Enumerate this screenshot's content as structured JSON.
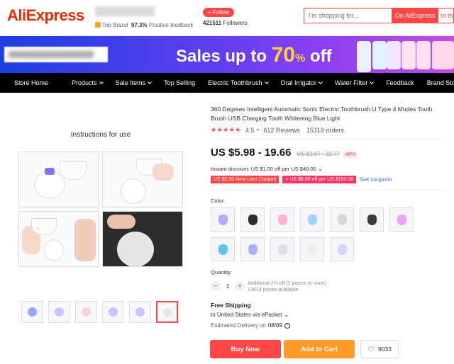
{
  "header": {
    "logo": "AliExpress",
    "store": {
      "badge": "Top Brand",
      "feedback_pct": "97.3%",
      "feedback_label": "Positive feedback",
      "follow_label": "+ Follow",
      "followers_count": "421511",
      "followers_label": "Followers"
    },
    "search": {
      "placeholder": "I'm shopping for...",
      "on_aliexpress": "On AliExpress",
      "in_store": "In this store"
    }
  },
  "banner": {
    "text_prefix": "Sales up to",
    "percent": "70",
    "percent_sign": "%",
    "text_suffix": "off"
  },
  "nav": {
    "items": [
      {
        "label": "Store Home",
        "dropdown": false
      },
      {
        "label": "Products",
        "dropdown": true
      },
      {
        "label": "Sale Items",
        "dropdown": true
      },
      {
        "label": "Top Selling",
        "dropdown": false
      },
      {
        "label": "Electric Toothbrush",
        "dropdown": true
      },
      {
        "label": "Oral Irrigator",
        "dropdown": true
      },
      {
        "label": "Water Filter",
        "dropdown": true
      },
      {
        "label": "Feedback",
        "dropdown": false
      },
      {
        "label": "Brand Story",
        "dropdown": false
      }
    ]
  },
  "gallery": {
    "main_caption": "Instructions for use",
    "thumb_count": 6,
    "active_thumb": 6
  },
  "product": {
    "title": "360 Degrees Intelligent Automatic Sonic Electric Toothbrush U Type 4 Modes Tooth Brush USB Charging Tooth Whitening Blue Light",
    "rating": "4.5",
    "reviews": "612 Reviews",
    "orders": "15319 orders",
    "price": "US $5.98 - 19.66",
    "old_price": "US $9.97 - 32.77",
    "discount": "-40%",
    "instant_discount": "Instant discount: US $1.00 off per US $49.00",
    "coupons": [
      "US $2.00 New User Coupon",
      "+ US $8.00 off per US $150.00"
    ],
    "get_coupons": "Get coupons",
    "color_label": "Color:",
    "swatch_colors": [
      "#b9a6ff",
      "#2b2b2b",
      "#ffb3cc",
      "#9fd6ff",
      "#d6d6d6",
      "#3a3a3a",
      "#e6a6ff",
      "#5bc6ea",
      "#a8b4ff",
      "#e0e0e0",
      "#ececec",
      "#cfd8ff"
    ],
    "quantity_label": "Quantity:",
    "quantity": "1",
    "qty_note_1": "Additional 2% off (2 pieces or more)",
    "qty_note_2": "13813 pieces available",
    "shipping_title": "Free Shipping",
    "shipping_dest": "to United States via ePacket",
    "eta_label": "Estimated Delivery on",
    "eta_date": "08/09",
    "buy_now": "Buy Now",
    "add_to_cart": "Add to Cart",
    "wishlist_count": "9033"
  }
}
